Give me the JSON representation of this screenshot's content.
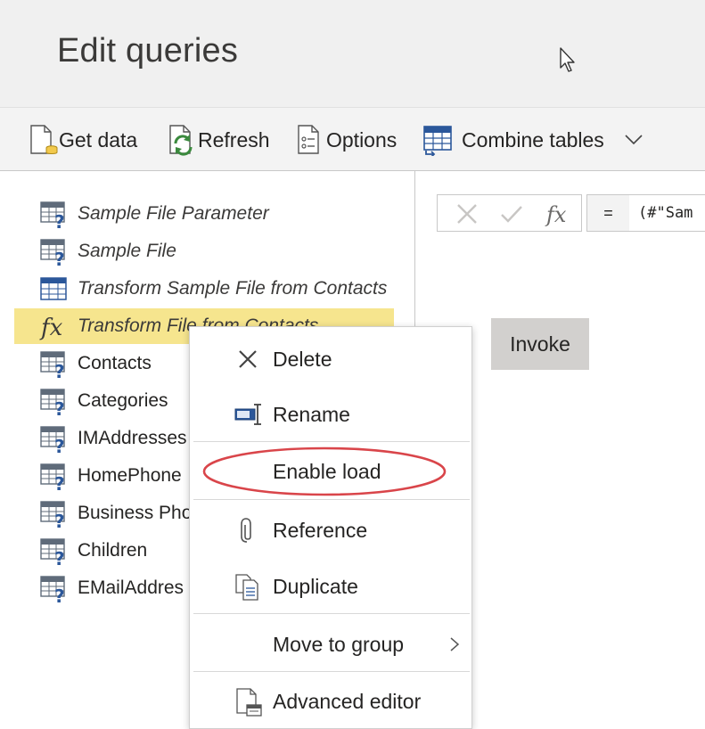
{
  "header": {
    "title": "Edit queries"
  },
  "toolbar": {
    "get_data": "Get data",
    "refresh": "Refresh",
    "options": "Options",
    "combine_tables": "Combine tables"
  },
  "queries": [
    {
      "label": "Sample File Parameter",
      "icon": "table-question-icon"
    },
    {
      "label": "Sample File",
      "icon": "table-question-icon"
    },
    {
      "label": "Transform Sample File from Contacts",
      "icon": "table-icon"
    },
    {
      "label": "Transform File from Contacts",
      "icon": "fx-icon"
    },
    {
      "label": "Contacts",
      "icon": "table-question-icon"
    },
    {
      "label": "Categories",
      "icon": "table-question-icon"
    },
    {
      "label": "IMAddresses",
      "icon": "table-question-icon"
    },
    {
      "label": "HomePhone",
      "icon": "table-question-icon"
    },
    {
      "label": "Business Pho",
      "icon": "table-question-icon"
    },
    {
      "label": "Children",
      "icon": "table-question-icon"
    },
    {
      "label": "EMailAddres",
      "icon": "table-question-icon"
    }
  ],
  "formula": {
    "equals": "=",
    "text": "(#\"Sam"
  },
  "invoke": {
    "label": "Invoke"
  },
  "context_menu": {
    "delete": "Delete",
    "rename": "Rename",
    "enable_load": "Enable load",
    "reference": "Reference",
    "duplicate": "Duplicate",
    "move_to_group": "Move to group",
    "advanced_editor": "Advanced editor"
  },
  "colors": {
    "selected_bg": "#f6e58e",
    "highlight_ring": "#d9454a",
    "accent_blue": "#2b579a",
    "refresh_green": "#3b8a3e"
  }
}
